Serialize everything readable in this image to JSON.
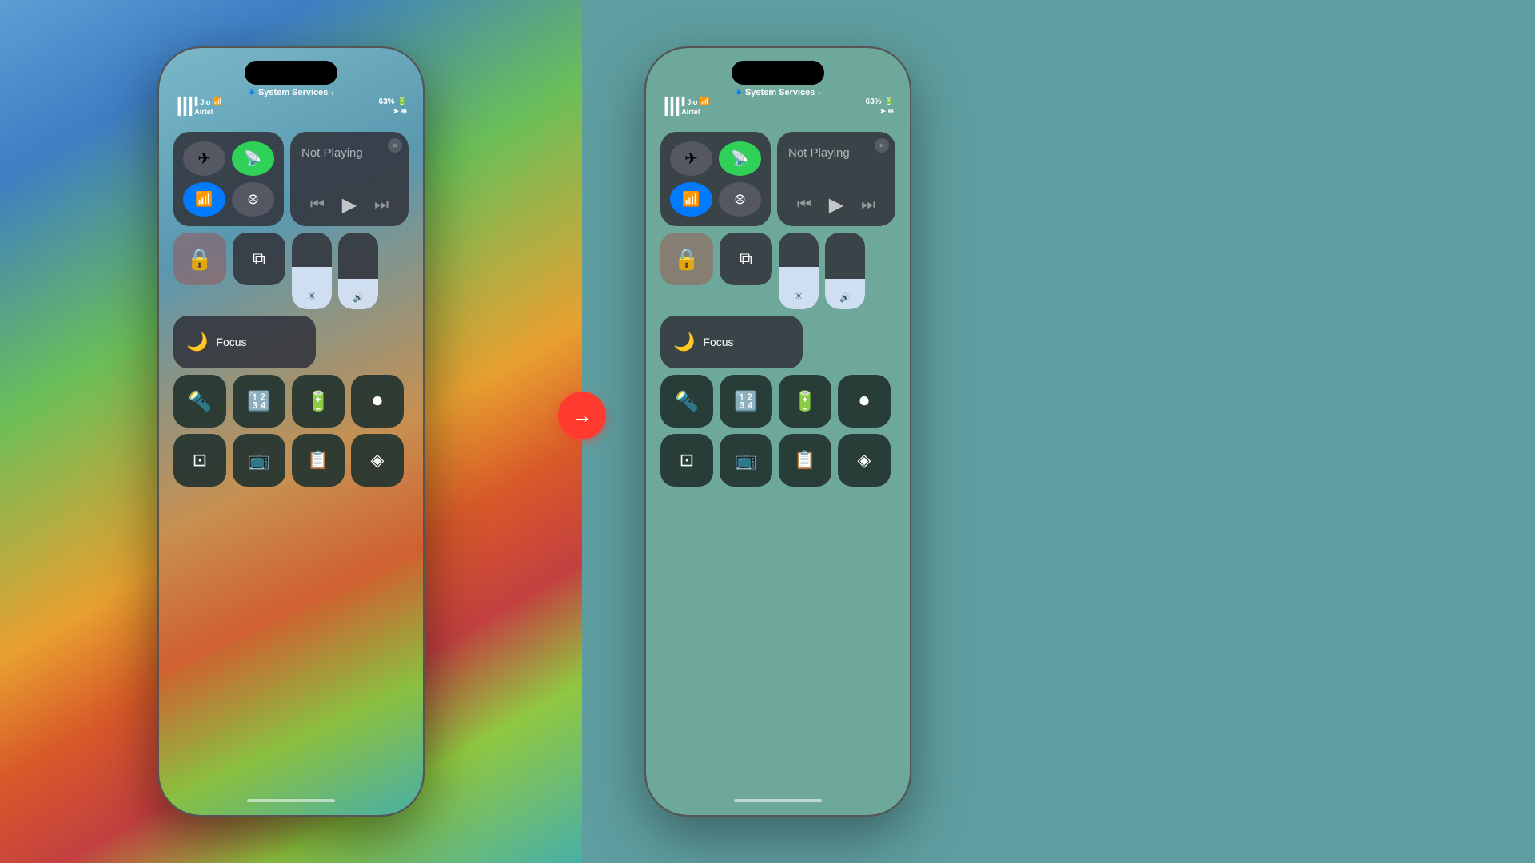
{
  "left_background": "linear-gradient colorful",
  "right_background": "teal",
  "arrow": {
    "symbol": "→",
    "color": "#ff3b30"
  },
  "phone_left": {
    "system_services": "System Services",
    "status": {
      "carrier1": "Jio",
      "carrier2": "Airtel",
      "battery": "63%",
      "location": true
    },
    "media": {
      "not_playing": "Not Playing"
    },
    "focus": {
      "label": "Focus"
    }
  },
  "phone_right": {
    "system_services": "System Services",
    "status": {
      "carrier1": "Jio",
      "carrier2": "Airtel",
      "battery": "63%"
    },
    "media": {
      "not_playing": "Not Playing"
    },
    "focus": {
      "label": "Focus"
    }
  }
}
